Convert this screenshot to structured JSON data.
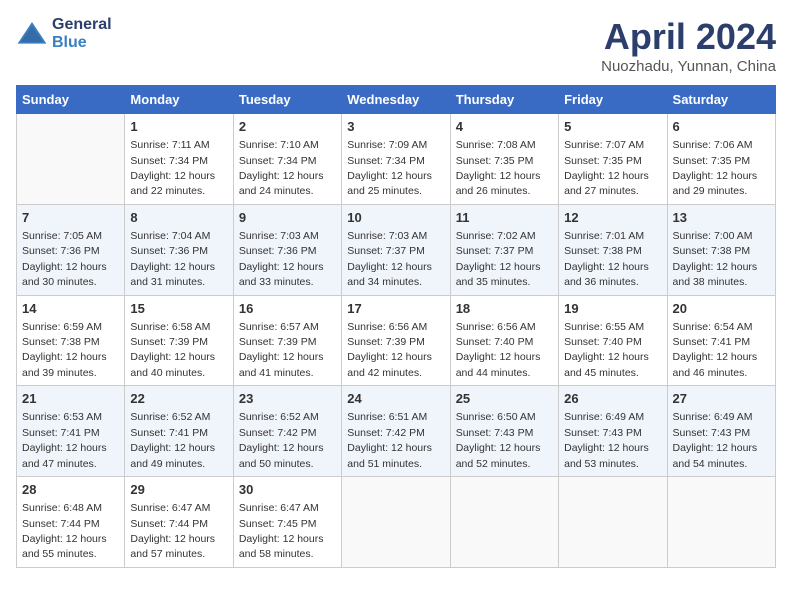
{
  "logo": {
    "line1": "General",
    "line2": "Blue"
  },
  "title": "April 2024",
  "subtitle": "Nuozhadu, Yunnan, China",
  "weekdays": [
    "Sunday",
    "Monday",
    "Tuesday",
    "Wednesday",
    "Thursday",
    "Friday",
    "Saturday"
  ],
  "weeks": [
    [
      {
        "day": "",
        "sunrise": "",
        "sunset": "",
        "daylight": ""
      },
      {
        "day": "1",
        "sunrise": "Sunrise: 7:11 AM",
        "sunset": "Sunset: 7:34 PM",
        "daylight": "Daylight: 12 hours and 22 minutes."
      },
      {
        "day": "2",
        "sunrise": "Sunrise: 7:10 AM",
        "sunset": "Sunset: 7:34 PM",
        "daylight": "Daylight: 12 hours and 24 minutes."
      },
      {
        "day": "3",
        "sunrise": "Sunrise: 7:09 AM",
        "sunset": "Sunset: 7:34 PM",
        "daylight": "Daylight: 12 hours and 25 minutes."
      },
      {
        "day": "4",
        "sunrise": "Sunrise: 7:08 AM",
        "sunset": "Sunset: 7:35 PM",
        "daylight": "Daylight: 12 hours and 26 minutes."
      },
      {
        "day": "5",
        "sunrise": "Sunrise: 7:07 AM",
        "sunset": "Sunset: 7:35 PM",
        "daylight": "Daylight: 12 hours and 27 minutes."
      },
      {
        "day": "6",
        "sunrise": "Sunrise: 7:06 AM",
        "sunset": "Sunset: 7:35 PM",
        "daylight": "Daylight: 12 hours and 29 minutes."
      }
    ],
    [
      {
        "day": "7",
        "sunrise": "Sunrise: 7:05 AM",
        "sunset": "Sunset: 7:36 PM",
        "daylight": "Daylight: 12 hours and 30 minutes."
      },
      {
        "day": "8",
        "sunrise": "Sunrise: 7:04 AM",
        "sunset": "Sunset: 7:36 PM",
        "daylight": "Daylight: 12 hours and 31 minutes."
      },
      {
        "day": "9",
        "sunrise": "Sunrise: 7:03 AM",
        "sunset": "Sunset: 7:36 PM",
        "daylight": "Daylight: 12 hours and 33 minutes."
      },
      {
        "day": "10",
        "sunrise": "Sunrise: 7:03 AM",
        "sunset": "Sunset: 7:37 PM",
        "daylight": "Daylight: 12 hours and 34 minutes."
      },
      {
        "day": "11",
        "sunrise": "Sunrise: 7:02 AM",
        "sunset": "Sunset: 7:37 PM",
        "daylight": "Daylight: 12 hours and 35 minutes."
      },
      {
        "day": "12",
        "sunrise": "Sunrise: 7:01 AM",
        "sunset": "Sunset: 7:38 PM",
        "daylight": "Daylight: 12 hours and 36 minutes."
      },
      {
        "day": "13",
        "sunrise": "Sunrise: 7:00 AM",
        "sunset": "Sunset: 7:38 PM",
        "daylight": "Daylight: 12 hours and 38 minutes."
      }
    ],
    [
      {
        "day": "14",
        "sunrise": "Sunrise: 6:59 AM",
        "sunset": "Sunset: 7:38 PM",
        "daylight": "Daylight: 12 hours and 39 minutes."
      },
      {
        "day": "15",
        "sunrise": "Sunrise: 6:58 AM",
        "sunset": "Sunset: 7:39 PM",
        "daylight": "Daylight: 12 hours and 40 minutes."
      },
      {
        "day": "16",
        "sunrise": "Sunrise: 6:57 AM",
        "sunset": "Sunset: 7:39 PM",
        "daylight": "Daylight: 12 hours and 41 minutes."
      },
      {
        "day": "17",
        "sunrise": "Sunrise: 6:56 AM",
        "sunset": "Sunset: 7:39 PM",
        "daylight": "Daylight: 12 hours and 42 minutes."
      },
      {
        "day": "18",
        "sunrise": "Sunrise: 6:56 AM",
        "sunset": "Sunset: 7:40 PM",
        "daylight": "Daylight: 12 hours and 44 minutes."
      },
      {
        "day": "19",
        "sunrise": "Sunrise: 6:55 AM",
        "sunset": "Sunset: 7:40 PM",
        "daylight": "Daylight: 12 hours and 45 minutes."
      },
      {
        "day": "20",
        "sunrise": "Sunrise: 6:54 AM",
        "sunset": "Sunset: 7:41 PM",
        "daylight": "Daylight: 12 hours and 46 minutes."
      }
    ],
    [
      {
        "day": "21",
        "sunrise": "Sunrise: 6:53 AM",
        "sunset": "Sunset: 7:41 PM",
        "daylight": "Daylight: 12 hours and 47 minutes."
      },
      {
        "day": "22",
        "sunrise": "Sunrise: 6:52 AM",
        "sunset": "Sunset: 7:41 PM",
        "daylight": "Daylight: 12 hours and 49 minutes."
      },
      {
        "day": "23",
        "sunrise": "Sunrise: 6:52 AM",
        "sunset": "Sunset: 7:42 PM",
        "daylight": "Daylight: 12 hours and 50 minutes."
      },
      {
        "day": "24",
        "sunrise": "Sunrise: 6:51 AM",
        "sunset": "Sunset: 7:42 PM",
        "daylight": "Daylight: 12 hours and 51 minutes."
      },
      {
        "day": "25",
        "sunrise": "Sunrise: 6:50 AM",
        "sunset": "Sunset: 7:43 PM",
        "daylight": "Daylight: 12 hours and 52 minutes."
      },
      {
        "day": "26",
        "sunrise": "Sunrise: 6:49 AM",
        "sunset": "Sunset: 7:43 PM",
        "daylight": "Daylight: 12 hours and 53 minutes."
      },
      {
        "day": "27",
        "sunrise": "Sunrise: 6:49 AM",
        "sunset": "Sunset: 7:43 PM",
        "daylight": "Daylight: 12 hours and 54 minutes."
      }
    ],
    [
      {
        "day": "28",
        "sunrise": "Sunrise: 6:48 AM",
        "sunset": "Sunset: 7:44 PM",
        "daylight": "Daylight: 12 hours and 55 minutes."
      },
      {
        "day": "29",
        "sunrise": "Sunrise: 6:47 AM",
        "sunset": "Sunset: 7:44 PM",
        "daylight": "Daylight: 12 hours and 57 minutes."
      },
      {
        "day": "30",
        "sunrise": "Sunrise: 6:47 AM",
        "sunset": "Sunset: 7:45 PM",
        "daylight": "Daylight: 12 hours and 58 minutes."
      },
      {
        "day": "",
        "sunrise": "",
        "sunset": "",
        "daylight": ""
      },
      {
        "day": "",
        "sunrise": "",
        "sunset": "",
        "daylight": ""
      },
      {
        "day": "",
        "sunrise": "",
        "sunset": "",
        "daylight": ""
      },
      {
        "day": "",
        "sunrise": "",
        "sunset": "",
        "daylight": ""
      }
    ]
  ]
}
